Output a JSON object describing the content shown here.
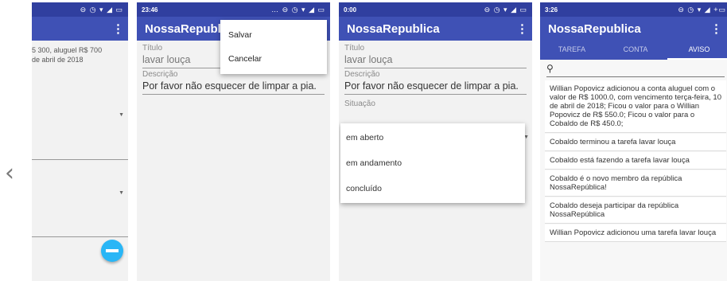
{
  "nav": {
    "prev_symbol": "‹"
  },
  "phone1": {
    "status_icons": "⊖ ◷ ▾ ◢ ▭",
    "text_line1": "5 300, aluguel R$ 700",
    "text_line2": "de abril de 2018"
  },
  "phone2": {
    "clock": "23:46",
    "status_icons": "… ⊖ ◷ ▾ ◢ ▭",
    "title": "NossaRepublica",
    "titulo_label": "Título",
    "titulo_value": "lavar louça",
    "descricao_label": "Descrição",
    "descricao_value": "Por favor não esquecer de limpar a pia.",
    "menu": [
      "Salvar",
      "Cancelar"
    ]
  },
  "phone3": {
    "clock": "0:00",
    "status_icons": "⊖ ◷ ▾ ◢ ▭",
    "title": "NossaRepublica",
    "menu_icon": "⋮",
    "titulo_label": "Título",
    "titulo_value": "lavar louça",
    "descricao_label": "Descrição",
    "descricao_value": "Por favor não esquecer de limpar a pia.",
    "situacao_label": "Situação",
    "options": [
      "em aberto",
      "em andamento",
      "concluído"
    ]
  },
  "phone4": {
    "clock": "3:26",
    "status_icons": "⊖ ◷ ▾ ◢ +▭",
    "title": "NossaRepublica",
    "menu_icon": "⋮",
    "tabs": [
      "TAREFA",
      "CONTA",
      "AVISO"
    ],
    "search_icon": "🔍",
    "feed": [
      "Willian Popovicz adicionou a conta aluguel com o valor de R$ 1000.0, com vencimento terça-feira, 10 de abril de 2018; Ficou o valor para o Willian Popovicz de R$ 550.0; Ficou o valor para o Cobaldo de R$ 450.0;",
      "Cobaldo terminou a tarefa lavar louça",
      "Cobaldo está fazendo a tarefa lavar louça",
      "Cobaldo é o novo membro da república NossaRepública!",
      "Cobaldo deseja participar da república NossaRepública",
      "Willian Popovicz adicionou uma tarefa lavar louça"
    ]
  },
  "colors": {
    "primary": "#3f51b5",
    "primary_dark": "#303f9f",
    "fab": "#29b6f6"
  }
}
